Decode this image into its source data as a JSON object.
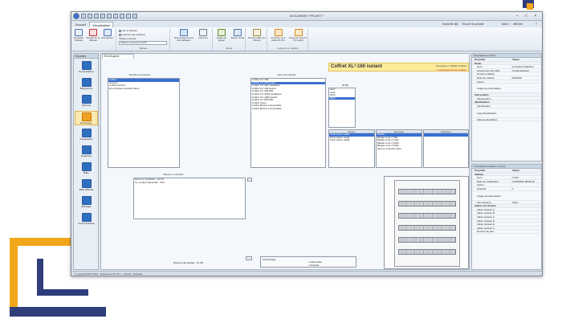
{
  "window": {
    "title": "DOCUMENT PROJET *",
    "help": "?"
  },
  "menu": {
    "tabs": [
      "Accueil",
      "Visualisation"
    ],
    "right_items": [
      "Nouvelle util.",
      "Trouver le produit",
      "Aide 1",
      "Afficher"
    ]
  },
  "ribbon": {
    "groups": [
      {
        "name": "Fichier",
        "buttons": [
          "Nouveau Tableau",
          "Supprimer le tableau",
          "Enregistrer"
        ]
      },
      {
        "name": "Tableau",
        "small": [
          "Voir le tableau",
          "Importer des tableaux",
          "Tableau courant"
        ],
        "select_value": "Tableau courant (1 tlab?)"
      },
      {
        "name": "Tableau",
        "buttons": [
          "Dimensionnement des tableaux",
          "Imprimer"
        ]
      },
      {
        "name": "Étude",
        "buttons": [
          "Étude de départ",
          "Étude circuit"
        ]
      },
      {
        "name": "Verrouillage",
        "buttons": [
          "Déverrouiller les fichiers"
        ]
      },
      {
        "name": "Logiciels en relation",
        "buttons": [
          "Importer vers étude XI-Pro",
          "Exporter vers XI-Pro Gen2"
        ]
      }
    ]
  },
  "sidebar": {
    "header": "Modules",
    "items": [
      {
        "label": "Nomenclature",
        "color": "#2f6fc0"
      },
      {
        "label": "Borgnerons",
        "color": "#2f6fc0"
      },
      {
        "label": "Schéma",
        "color": "#2f6fc0"
      },
      {
        "label": "Enveloppe",
        "color": "#f0a020"
      },
      {
        "label": "Visualisation",
        "color": "#2f6fc0"
      },
      {
        "label": "Repérées",
        "color": "#2f6fc0"
      },
      {
        "label": "Bilan",
        "color": "#2f6fc0"
      },
      {
        "label": "Bilan d'Étude",
        "color": "#2f6fc0"
      },
      {
        "label": "Affichage",
        "color": "#2f6fc0"
      },
      {
        "label": "Communication",
        "color": "#2f6fc0"
      }
    ]
  },
  "document_tab": "Enveloppes",
  "families": {
    "header": "Famille d'enveloppe",
    "items": [
      "Coffret",
      "Armoire",
      "Coffret étanche",
      "En enceintes transformateur"
    ],
    "selected": 0
  },
  "types": {
    "header": "Type d'enveloppe",
    "items": [
      "Coffret XL³ 160",
      "Coffret XL³ 160 isolant",
      "Coffret XL³ 400 métallique",
      "Coffret XL³ 400 isolant",
      "Coffret XL³ 400 800",
      "Coffret XL³ 4000 métallique",
      "Coffret XL³ 4000 isolant",
      "Coffret XL³ 800 800",
      "Coffret Nuom",
      "Coffret Marina Composable",
      "Coffret Marina Composable"
    ],
    "selected": 1
  },
  "product": {
    "title": "Coffret XL³-160 isolant",
    "reference": "Enveloppe 1 20604 (Coffret)",
    "warning": "7 rangées(s) de 24 modules",
    "depth_label": "(P 80)",
    "depth_options": [
      "3x24",
      "4x24",
      "5x24",
      "6x24"
    ],
    "depth_selected": 3
  },
  "columns": {
    "left": {
      "header": "Portes",
      "items": [
        "Porte pleine métal",
        "Porte pleine métal",
        "Porte pleine métal"
      ]
    },
    "mid": {
      "header": "Serrures",
      "items": [
        "Barillet",
        "Barillet à clé n°405",
        "Barillet à clé n°1242",
        "Barillet à clé n°2433",
        "Barillet à clé n°2341",
        "Serrure à double barre"
      ]
    },
    "right": {
      "header": "Plastrons",
      "items": []
    }
  },
  "reserve": {
    "header": "Réserve modulaire",
    "lines": [
      "Réserve modulaire : 24.7%",
      "Un module disponible : 25.0"
    ],
    "label": "Réserve demandée : 31.3%"
  },
  "assembly": {
    "label": "Assemblage",
    "options": [
      "Horizontale",
      "Verticale"
    ]
  },
  "properties_top": {
    "header": "Propriétés de l'étude",
    "columns": [
      "Propriété",
      "Valeur"
    ],
    "rows": [
      {
        "k": "Étude",
        "v": "",
        "cat": true
      },
      {
        "k": "Nom",
        "v": "Nouvelle installation"
      },
      {
        "k": "Groupement de l'affa...",
        "v": "Systématisation"
      },
      {
        "k": "Numéro d'affaire",
        "v": ""
      },
      {
        "k": "Date de création",
        "v": "30/03/20"
      },
      {
        "k": "Auteur",
        "v": ""
      },
      {
        "k": "Image de présentation",
        "v": "",
        "tall": true
      },
      {
        "k": "Intervenants",
        "v": "",
        "cat": true
      },
      {
        "k": "Intervenant 1",
        "v": ""
      },
      {
        "k": "Identification",
        "v": "",
        "cat": true
      },
      {
        "k": "Identification",
        "v": ""
      },
      {
        "k": "Logo Identification",
        "v": "",
        "tall": true
      },
      {
        "k": "Adresse Identificat...",
        "v": ""
      }
    ]
  },
  "properties_bottom": {
    "header": "Propriétés du tableau courant",
    "columns": [
      "Propriété",
      "Valeur"
    ],
    "rows": [
      {
        "k": "Tableau",
        "v": "",
        "cat": true
      },
      {
        "k": "Nom",
        "v": "T-A01"
      },
      {
        "k": "Date de modification",
        "v": "27/05/2022 08:09:46"
      },
      {
        "k": "Auteur",
        "v": ""
      },
      {
        "k": "Quantité",
        "v": "1"
      },
      {
        "k": "Image de présentation",
        "v": "",
        "tall": true
      },
      {
        "k": "ICC présumé",
        "v": "10kA"
      },
      {
        "k": "Indices de révision",
        "v": "",
        "cat": true
      },
      {
        "k": "Indice révision A",
        "v": ""
      },
      {
        "k": "Indice révision B",
        "v": ""
      },
      {
        "k": "Indice révision C",
        "v": ""
      },
      {
        "k": "Indice révision D",
        "v": ""
      },
      {
        "k": "Indice révision E",
        "v": ""
      },
      {
        "k": "Indice révision F",
        "v": ""
      },
      {
        "k": "Numéro de plan",
        "v": ""
      }
    ]
  },
  "status": "© Legrand 2007-2022 · Ressource XL³ Pro · 1.00.44 · Français"
}
